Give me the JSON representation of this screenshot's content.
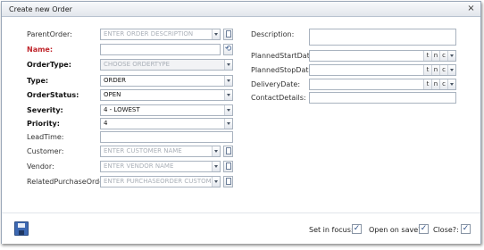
{
  "window": {
    "title": "Create new Order",
    "close": "×"
  },
  "left_form": {
    "parent_order": {
      "label": "ParentOrder:",
      "placeholder": "ENTER ORDER DESCRIPTION"
    },
    "name": {
      "label": "Name:",
      "value": ""
    },
    "order_type": {
      "label": "OrderType:",
      "placeholder": "CHOOSE ORDERTYPE"
    },
    "type": {
      "label": "Type:",
      "value": "ORDER"
    },
    "order_status": {
      "label": "OrderStatus:",
      "value": "OPEN"
    },
    "severity": {
      "label": "Severity:",
      "value": "4 - LOWEST"
    },
    "priority": {
      "label": "Priority:",
      "value": "4"
    },
    "lead_time": {
      "label": "LeadTime:",
      "value": ""
    },
    "customer": {
      "label": "Customer:",
      "placeholder": "ENTER CUSTOMER NAME"
    },
    "vendor": {
      "label": "Vendor:",
      "placeholder": "ENTER VENDOR NAME"
    },
    "related_purchase_order": {
      "label": "RelatedPurchaseOrder:",
      "placeholder": "ENTER PURCHASEORDER CUSTOME"
    }
  },
  "right_form": {
    "description": {
      "label": "Description:",
      "value": ""
    },
    "planned_start_date": {
      "label": "PlannedStartDate:",
      "value": ""
    },
    "planned_stop_date": {
      "label": "PlannedStopDate:",
      "value": ""
    },
    "delivery_date": {
      "label": "DeliveryDate:",
      "value": ""
    },
    "contact_details": {
      "label": "ContactDetails:",
      "value": ""
    },
    "date_buttons": {
      "t": "t",
      "n": "n",
      "c": "c"
    }
  },
  "footer": {
    "set_in_focus": {
      "label": "Set in focus:",
      "checked": true
    },
    "open_on_save": {
      "label": "Open on save?:",
      "checked": true
    },
    "close": {
      "label": "Close?:",
      "checked": true
    },
    "check_mark": "✓"
  },
  "icons": {
    "dropdown": "chevron-down-icon",
    "new": "new-document-icon",
    "refresh": "refresh-icon",
    "save": "save-icon",
    "close": "close-icon"
  },
  "colors": {
    "required_label": "#c0262c",
    "titlebar": "#e2e6ec",
    "border": "#a9b3bf",
    "save_button": "#3c68b2"
  }
}
